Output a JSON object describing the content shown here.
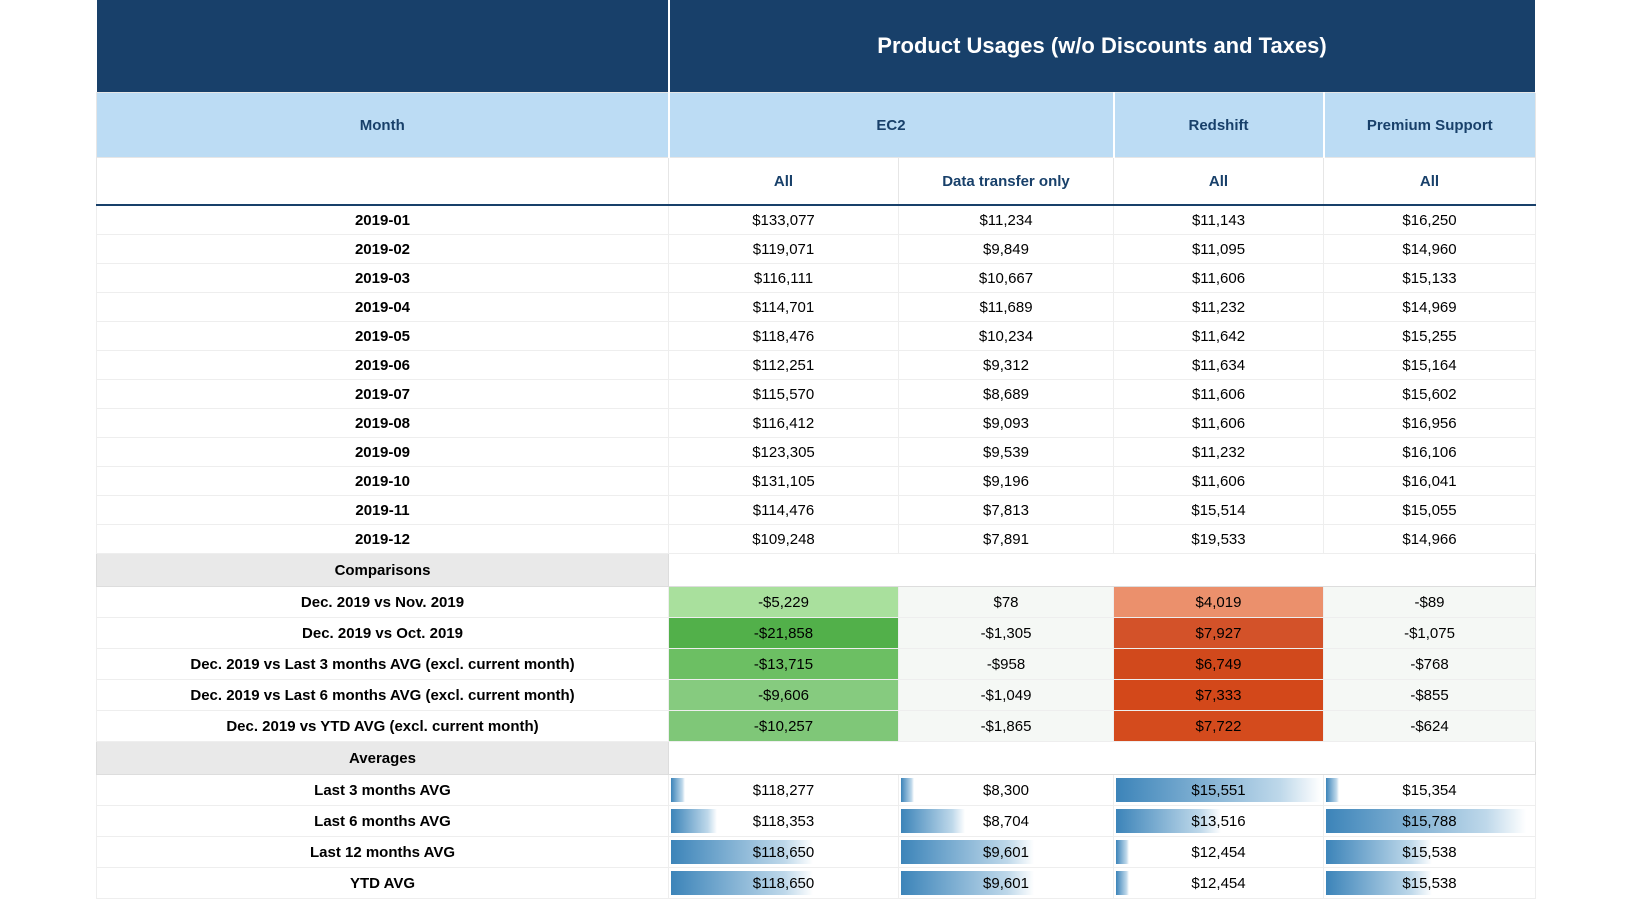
{
  "title": "Product Usages (w/o Discounts and Taxes)",
  "headers": {
    "month": "Month",
    "ec2": "EC2",
    "redshift": "Redshift",
    "premium": "Premium Support",
    "sub_ec2_all": "All",
    "sub_ec2_dto": "Data transfer only",
    "sub_redshift": "All",
    "sub_premium": "All"
  },
  "sections": {
    "comparisons": "Comparisons",
    "averages": "Averages"
  },
  "rows": [
    {
      "month": "2019-01",
      "ec2_all": "$133,077",
      "ec2_dto": "$11,234",
      "redshift": "$11,143",
      "premium": "$16,250"
    },
    {
      "month": "2019-02",
      "ec2_all": "$119,071",
      "ec2_dto": "$9,849",
      "redshift": "$11,095",
      "premium": "$14,960"
    },
    {
      "month": "2019-03",
      "ec2_all": "$116,111",
      "ec2_dto": "$10,667",
      "redshift": "$11,606",
      "premium": "$15,133"
    },
    {
      "month": "2019-04",
      "ec2_all": "$114,701",
      "ec2_dto": "$11,689",
      "redshift": "$11,232",
      "premium": "$14,969"
    },
    {
      "month": "2019-05",
      "ec2_all": "$118,476",
      "ec2_dto": "$10,234",
      "redshift": "$11,642",
      "premium": "$15,255"
    },
    {
      "month": "2019-06",
      "ec2_all": "$112,251",
      "ec2_dto": "$9,312",
      "redshift": "$11,634",
      "premium": "$15,164"
    },
    {
      "month": "2019-07",
      "ec2_all": "$115,570",
      "ec2_dto": "$8,689",
      "redshift": "$11,606",
      "premium": "$15,602"
    },
    {
      "month": "2019-08",
      "ec2_all": "$116,412",
      "ec2_dto": "$9,093",
      "redshift": "$11,606",
      "premium": "$16,956"
    },
    {
      "month": "2019-09",
      "ec2_all": "$123,305",
      "ec2_dto": "$9,539",
      "redshift": "$11,232",
      "premium": "$16,106"
    },
    {
      "month": "2019-10",
      "ec2_all": "$131,105",
      "ec2_dto": "$9,196",
      "redshift": "$11,606",
      "premium": "$16,041"
    },
    {
      "month": "2019-11",
      "ec2_all": "$114,476",
      "ec2_dto": "$7,813",
      "redshift": "$15,514",
      "premium": "$15,055"
    },
    {
      "month": "2019-12",
      "ec2_all": "$109,248",
      "ec2_dto": "$7,891",
      "redshift": "$19,533",
      "premium": "$14,966"
    }
  ],
  "comparisons": [
    {
      "label": "Dec. 2019 vs Nov. 2019",
      "ec2_all": "-$5,229",
      "ec2_all_cls": "g1",
      "ec2_dto": "$78",
      "redshift": "$4,019",
      "redshift_cls": "r1",
      "premium": "-$89"
    },
    {
      "label": "Dec. 2019 vs Oct. 2019",
      "ec2_all": "-$21,858",
      "ec2_all_cls": "g2",
      "ec2_dto": "-$1,305",
      "redshift": "$7,927",
      "redshift_cls": "r2",
      "premium": "-$1,075"
    },
    {
      "label": "Dec. 2019 vs Last 3 months AVG (excl. current month)",
      "ec2_all": "-$13,715",
      "ec2_all_cls": "g3",
      "ec2_dto": "-$958",
      "redshift": "$6,749",
      "redshift_cls": "r3",
      "premium": "-$768"
    },
    {
      "label": "Dec. 2019 vs Last 6 months AVG (excl. current month)",
      "ec2_all": "-$9,606",
      "ec2_all_cls": "g4",
      "ec2_dto": "-$1,049",
      "redshift": "$7,333",
      "redshift_cls": "r4",
      "premium": "-$855"
    },
    {
      "label": "Dec. 2019 vs YTD AVG (excl. current month)",
      "ec2_all": "-$10,257",
      "ec2_all_cls": "g5",
      "ec2_dto": "-$1,865",
      "redshift": "$7,722",
      "redshift_cls": "r5",
      "premium": "-$624"
    }
  ],
  "averages": [
    {
      "label": "Last 3 months AVG",
      "ec2_all": "$118,277",
      "ec2_all_bar": 6,
      "ec2_dto": "$8,300",
      "ec2_dto_bar": 6,
      "redshift": "$15,551",
      "redshift_bar": 98,
      "premium": "$15,354",
      "premium_bar": 6
    },
    {
      "label": "Last 6 months AVG",
      "ec2_all": "$118,353",
      "ec2_all_bar": 20,
      "ec2_dto": "$8,704",
      "ec2_dto_bar": 30,
      "redshift": "$13,516",
      "redshift_bar": 50,
      "premium": "$15,788",
      "premium_bar": 95
    },
    {
      "label": "Last 12 months AVG",
      "ec2_all": "$118,650",
      "ec2_all_bar": 62,
      "ec2_dto": "$9,601",
      "ec2_dto_bar": 62,
      "redshift": "$12,454",
      "redshift_bar": 6,
      "premium": "$15,538",
      "premium_bar": 50
    },
    {
      "label": "YTD AVG",
      "ec2_all": "$118,650",
      "ec2_all_bar": 62,
      "ec2_dto": "$9,601",
      "ec2_dto_bar": 62,
      "redshift": "$12,454",
      "redshift_bar": 6,
      "premium": "$15,538",
      "premium_bar": 50
    }
  ]
}
